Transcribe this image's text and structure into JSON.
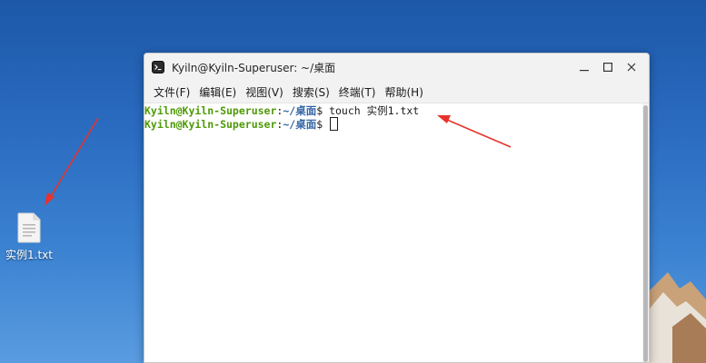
{
  "desktop": {
    "icons": [
      {
        "label": "实例1.txt",
        "icon": "text-file-icon"
      }
    ]
  },
  "window": {
    "title": "Kyiln@Kyiln-Superuser: ~/桌面",
    "icon": "terminal-icon",
    "controls": {
      "minimize": "minimize-icon",
      "maximize": "maximize-icon",
      "close": "close-icon"
    },
    "menu": [
      {
        "label": "文件(F)"
      },
      {
        "label": "编辑(E)"
      },
      {
        "label": "视图(V)"
      },
      {
        "label": "搜索(S)"
      },
      {
        "label": "终端(T)"
      },
      {
        "label": "帮助(H)"
      }
    ]
  },
  "terminal": {
    "lines": [
      {
        "user": "Kyiln@Kyiln-Superuser",
        "colon": ":",
        "path": "~/桌面",
        "dollar": "$",
        "command": " touch 实例1.txt"
      },
      {
        "user": "Kyiln@Kyiln-Superuser",
        "colon": ":",
        "path": "~/桌面",
        "dollar": "$",
        "command": " "
      }
    ]
  },
  "colors": {
    "prompt_user": "#4e9a06",
    "prompt_path": "#3465a4",
    "annotation_arrow": "#e8322b",
    "desktop_blue": "#2a6bc0"
  }
}
